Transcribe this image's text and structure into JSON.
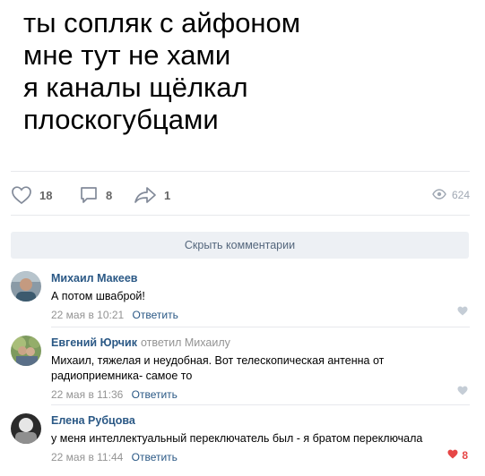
{
  "post": {
    "text_lines": [
      "ты сопляк с айфоном",
      "мне тут не хами",
      "я каналы щёлкал",
      "плоскогубцами"
    ],
    "likes": "18",
    "comments": "8",
    "shares": "1",
    "views": "624"
  },
  "comments_section": {
    "hide_label": "Скрыть комментарии",
    "reply_label": "Ответить",
    "items": [
      {
        "author": "Михаил Макеев",
        "reply_to": "",
        "text": "А потом шваброй!",
        "date": "22 мая в 10:21",
        "likes": ""
      },
      {
        "author": "Евгений Юрчик",
        "reply_to": "ответил Михаилу",
        "text": "Михаил, тяжелая и неудобная. Вот телескопическая антенна от радиоприемника- самое то",
        "date": "22 мая в 11:36",
        "likes": ""
      },
      {
        "author": "Елена Рубцова",
        "reply_to": "",
        "text": "у меня интеллектуальный переключатель был - я братом переключала",
        "date": "22 мая в 11:44",
        "likes": "8"
      }
    ]
  },
  "colors": {
    "link": "#2a5885",
    "muted": "#939393",
    "like_active": "#e64646",
    "button_bg": "#edf0f4"
  }
}
